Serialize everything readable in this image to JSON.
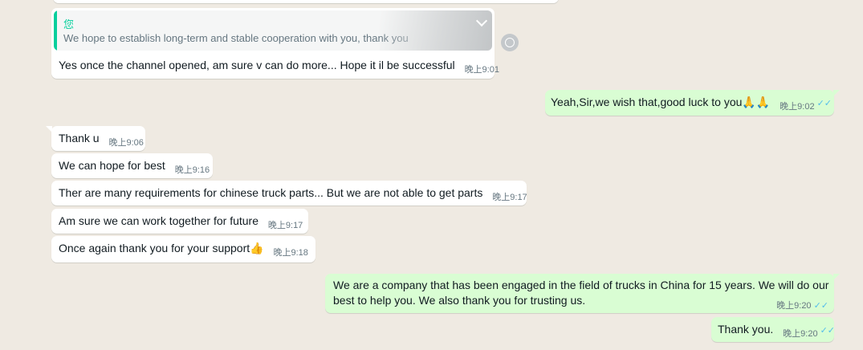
{
  "quoted_message": {
    "author": "您",
    "text": "We hope to establish long-term and stable cooperation with you, thank you"
  },
  "messages": [
    {
      "direction": "incoming",
      "text": "Yes once the channel opened, am sure v can do more... Hope it il be successful",
      "time": "晚上9:01"
    },
    {
      "direction": "outgoing",
      "text": "Yeah,Sir,we wish that,good luck to you🙏🙏",
      "time": "晚上9:02",
      "status": "read"
    },
    {
      "direction": "incoming",
      "text": "Thank u",
      "time": "晚上9:06"
    },
    {
      "direction": "incoming",
      "text": "We can hope for best",
      "time": "晚上9:16"
    },
    {
      "direction": "incoming",
      "text": "Ther are many requirements for chinese truck parts... But we are not able to get parts",
      "time": "晚上9:17"
    },
    {
      "direction": "incoming",
      "text": "Am sure we can work together for future",
      "time": "晚上9:17"
    },
    {
      "direction": "incoming",
      "text": "Once again thank you for your support👍",
      "time": "晚上9:18"
    },
    {
      "direction": "outgoing",
      "text_line1": "We are a company that has been engaged in the field of trucks in China for 15 years. We will do our",
      "text_line2": "best to help you. We also thank you for trusting us.",
      "time": "晚上9:20",
      "status": "read"
    },
    {
      "direction": "outgoing",
      "text": "Thank you.",
      "time": "晚上9:20",
      "status": "read"
    }
  ],
  "read_tick": "✓✓",
  "colors": {
    "background": "#efeae2",
    "incoming_bubble": "#ffffff",
    "outgoing_bubble": "#d9fdd3",
    "quote_accent": "#06cf9c",
    "meta_text": "#667781",
    "read_tick": "#53bdeb"
  },
  "icons": {
    "react": "emoji-icon",
    "menu": "chevron-down-icon",
    "status": "double-check-icon"
  }
}
